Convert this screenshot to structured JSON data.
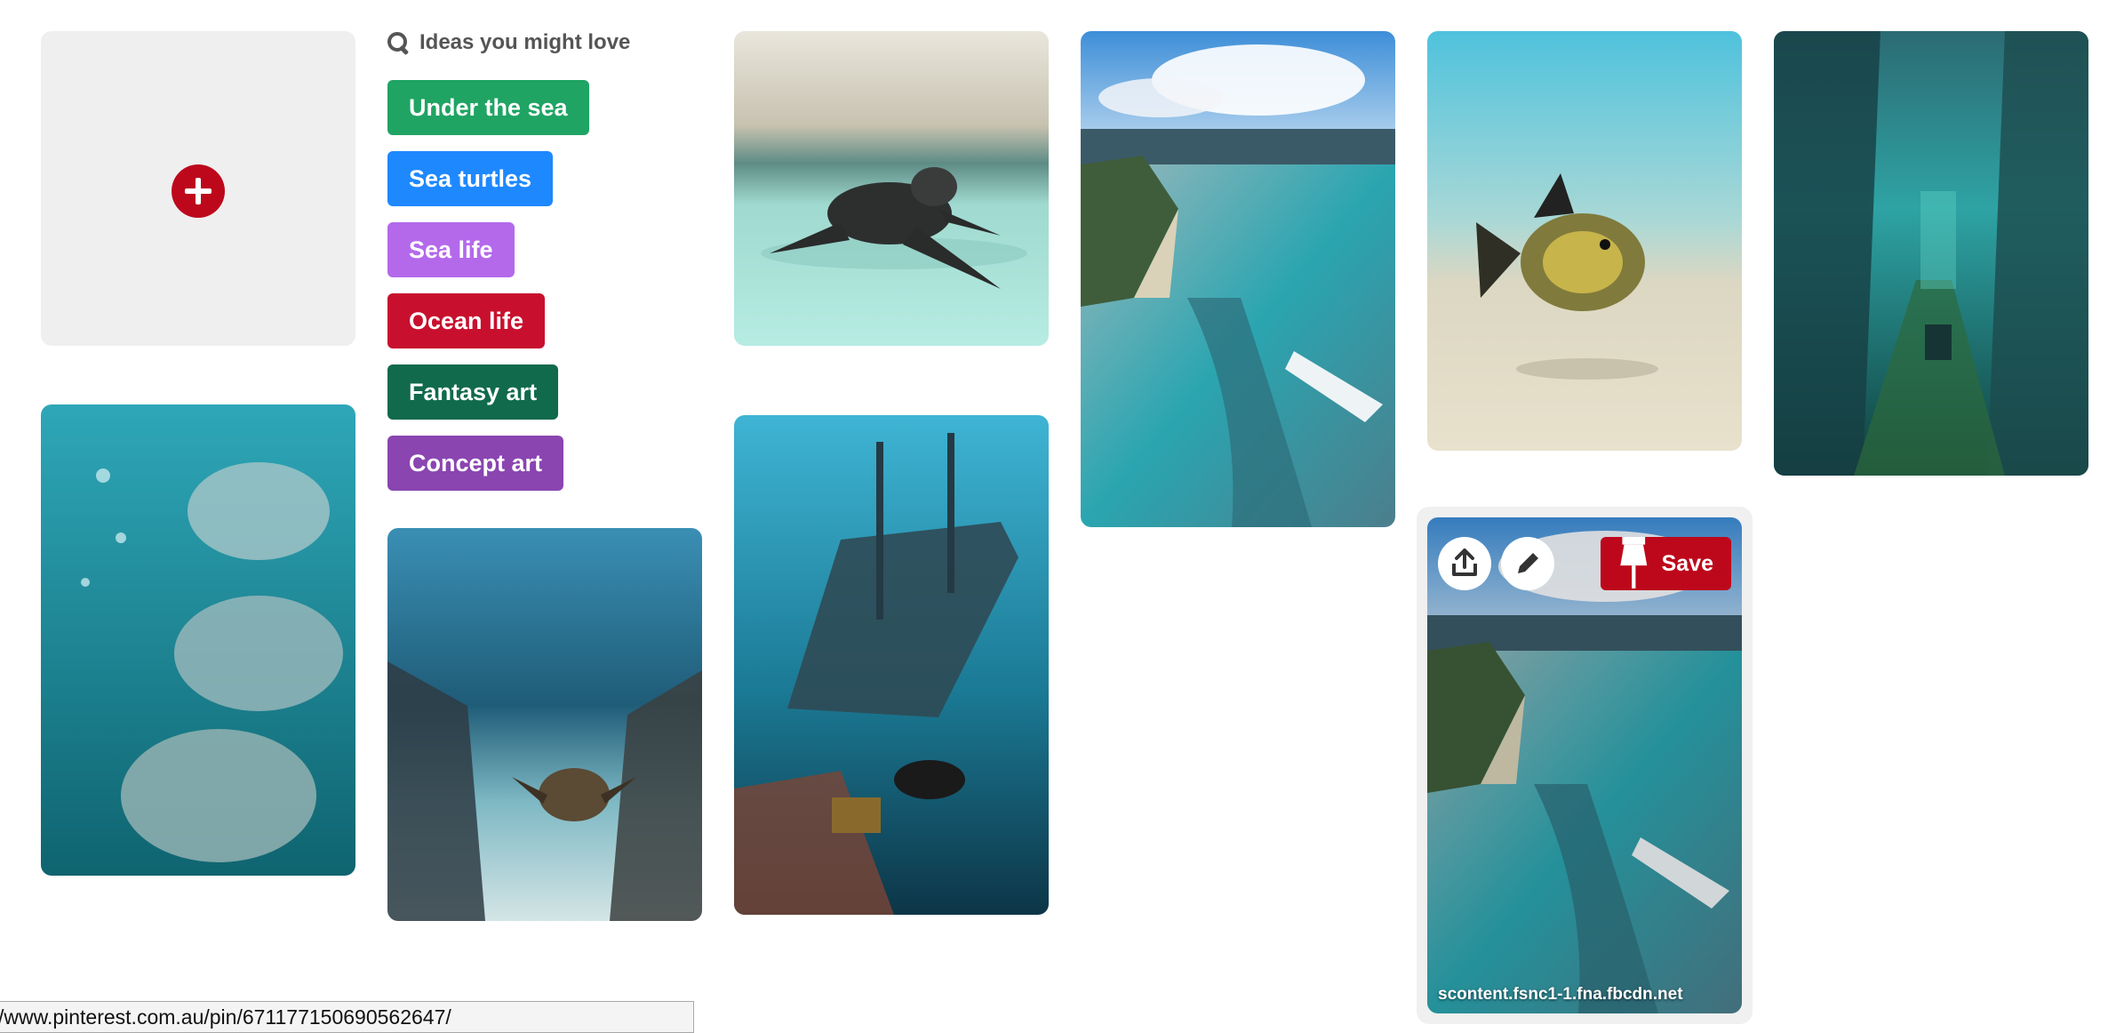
{
  "colors": {
    "brand_red": "#bd081c",
    "tile_gray": "#efefef"
  },
  "add_pin": {
    "icon": "add-circle-icon"
  },
  "ideas": {
    "title": "Ideas you might love",
    "icon": "search-icon",
    "items": [
      {
        "label": "Under the sea",
        "color": "#1fa463"
      },
      {
        "label": "Sea turtles",
        "color": "#1e88ff"
      },
      {
        "label": "Sea life",
        "color": "#b469eb"
      },
      {
        "label": "Ocean life",
        "color": "#c8102e"
      },
      {
        "label": "Fantasy art",
        "color": "#116a4c"
      },
      {
        "label": "Concept art",
        "color": "#8a45b0"
      }
    ]
  },
  "hovered_pin": {
    "save_label": "Save",
    "source": "scontent.fsnc1-1.fna.fbcdn.net",
    "share_icon": "share-icon",
    "edit_icon": "pencil-icon",
    "pin_icon": "pushpin-icon"
  },
  "status_bar": {
    "url": "/www.pinterest.com.au/pin/671177150690562647/"
  }
}
